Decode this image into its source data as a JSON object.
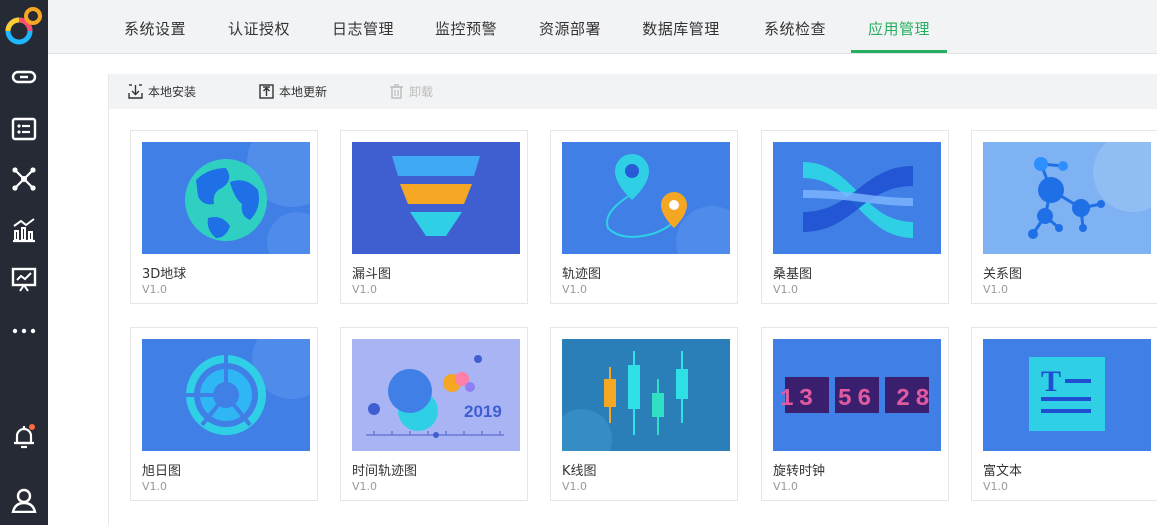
{
  "nav": {
    "tabs": [
      {
        "label": "系统设置"
      },
      {
        "label": "认证授权"
      },
      {
        "label": "日志管理"
      },
      {
        "label": "监控预警"
      },
      {
        "label": "资源部署"
      },
      {
        "label": "数据库管理"
      },
      {
        "label": "系统检查"
      },
      {
        "label": "应用管理"
      }
    ],
    "active_tab": "应用管理"
  },
  "sidebar": {
    "icons": [
      "app-logo",
      "link-icon",
      "list-icon",
      "network-icon",
      "chart-icon",
      "presentation-icon",
      "more-icon",
      "bell-icon",
      "user-icon"
    ],
    "notification_dot": true
  },
  "toolbar": {
    "install_label": "本地安装",
    "update_label": "本地更新",
    "uninstall_label": "卸载",
    "uninstall_disabled": true
  },
  "apps": [
    {
      "name": "3D地球",
      "version": "V1.0"
    },
    {
      "name": "漏斗图",
      "version": "V1.0"
    },
    {
      "name": "轨迹图",
      "version": "V1.0"
    },
    {
      "name": "桑基图",
      "version": "V1.0"
    },
    {
      "name": "关系图",
      "version": "V1.0"
    },
    {
      "name": "旭日图",
      "version": "V1.0"
    },
    {
      "name": "时间轨迹图",
      "version": "V1.0",
      "thumb_text": "2019"
    },
    {
      "name": "K线图",
      "version": "V1.0"
    },
    {
      "name": "旋转时钟",
      "version": "V1.0",
      "thumb_text": "13 56 28"
    },
    {
      "name": "富文本",
      "version": "V1.0",
      "thumb_text": "T"
    }
  ],
  "colors": {
    "accent": "#27ae60",
    "rail": "#252a35",
    "thumb_blue": "#3f7fe6"
  }
}
